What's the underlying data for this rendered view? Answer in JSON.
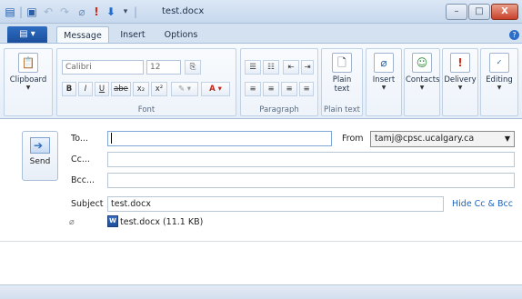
{
  "window": {
    "title": "test.docx"
  },
  "quick_access": {
    "icons": [
      "app-icon",
      "save-icon",
      "undo-icon",
      "redo-icon",
      "attach-icon",
      "importance-icon",
      "arrow-down-icon",
      "customize-icon"
    ]
  },
  "window_controls": {
    "minimize": "–",
    "maximize": "□",
    "close": "X"
  },
  "ribbon_tabs": {
    "file": "▤ ▾",
    "message": "Message",
    "insert": "Insert",
    "options": "Options"
  },
  "ribbon": {
    "clipboard": {
      "button": "Clipboard"
    },
    "font": {
      "name": "Calibri",
      "size": "12",
      "bold": "B",
      "italic": "I",
      "underline": "U",
      "strike": "abe",
      "subscript": "x₂",
      "superscript": "x²",
      "group_label": "Font"
    },
    "paragraph": {
      "group_label": "Paragraph"
    },
    "plain_text": {
      "button_line1": "Plain",
      "button_line2": "text",
      "group_label": "Plain text"
    },
    "insert": {
      "button": "Insert"
    },
    "contacts": {
      "button": "Contacts"
    },
    "delivery": {
      "button": "Delivery"
    },
    "editing": {
      "button": "Editing"
    }
  },
  "compose": {
    "send_label": "Send",
    "to_label": "To...",
    "to_value": "",
    "cc_label": "Cc...",
    "cc_value": "",
    "bcc_label": "Bcc...",
    "bcc_value": "",
    "from_label": "From",
    "from_value": "tamj@cpsc.ucalgary.ca",
    "subject_label": "Subject",
    "subject_value": "test.docx",
    "hide_cc_bcc": "Hide Cc & Bcc",
    "attachment": "test.docx (11.1 KB)"
  }
}
